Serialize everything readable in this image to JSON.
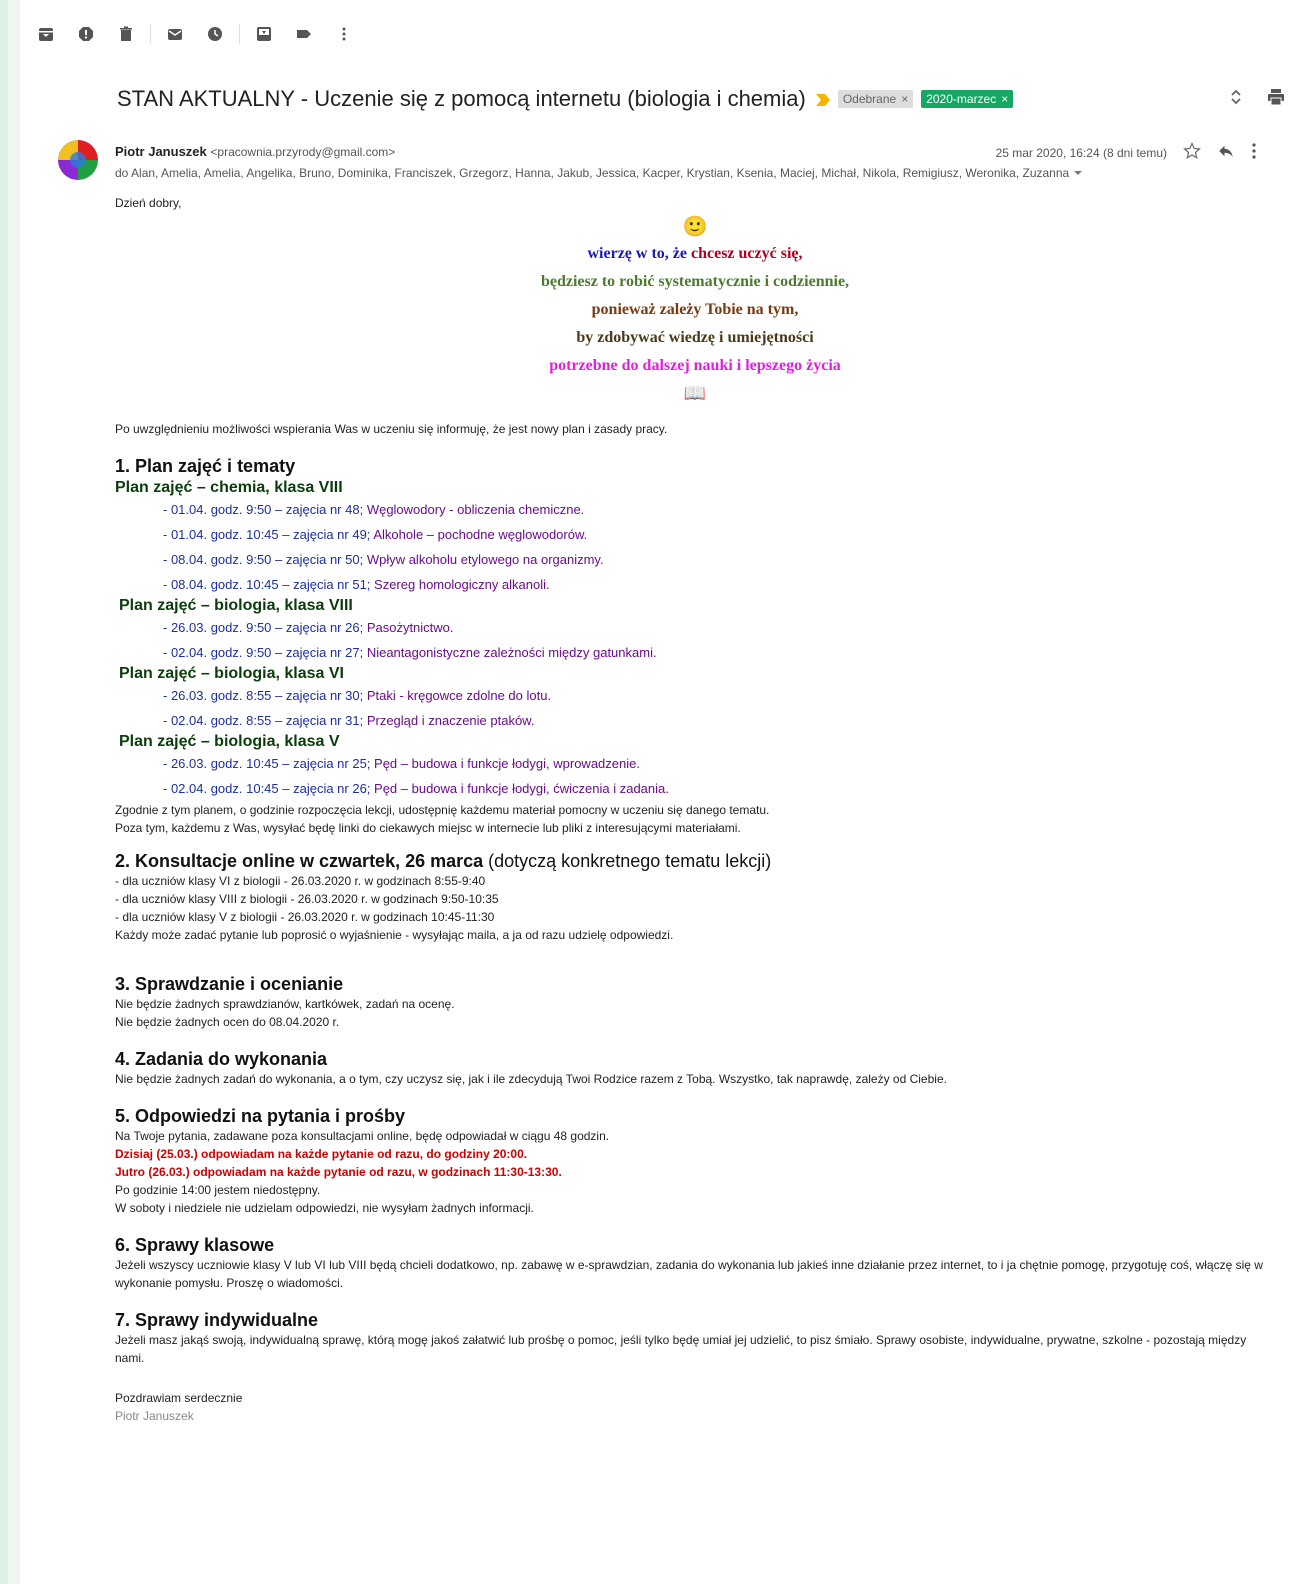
{
  "toolbar": {
    "icons": [
      "archive-icon",
      "report-spam-icon",
      "delete-icon",
      "mark-unread-icon",
      "snooze-icon",
      "move-to-icon",
      "labels-icon",
      "more-icon"
    ]
  },
  "subject": "STAN AKTUALNY - Uczenie się z pomocą internetu (biologia i chemia)",
  "labels": [
    {
      "text": "Odebrane",
      "color": "#dddddd"
    },
    {
      "text": "2020-marzec",
      "color": "#16a765"
    }
  ],
  "label_close": "×",
  "sender": {
    "name": "Piotr Januszek",
    "email": "<pracownia.przyrody@gmail.com>",
    "date": "25 mar 2020, 16:24 (8 dni temu)",
    "recipients": "do Alan, Amelia, Amelia, Angelika, Bruno, Dominika, Franciszek, Grzegorz, Hanna, Jakub, Jessica, Kacper, Krystian, Ksenia, Maciej, Michał, Nikola, Remigiusz, Weronika, Zuzanna"
  },
  "greeting": "Dzień dobry,",
  "emoji_smile": "🙂",
  "emoji_book": "📖",
  "motto": {
    "l1a": "wierzę w to, że ",
    "l1b": "chcesz uczyć się,",
    "l2": "będziesz to robić systematycznie i codziennie,",
    "l3": "ponieważ zależy Tobie na tym,",
    "l4": "by zdobywać wiedzę i umiejętności",
    "l5": "potrzebne do dalszej nauki i lepszego życia",
    "colors": {
      "blue": "#1a1ab3",
      "red": "#b00020",
      "green": "#4c7a2e",
      "brown": "#7a3b12",
      "dark": "#4a3a1a",
      "magenta": "#e020e0"
    }
  },
  "intro": "Po uwzględnieniu możliwości wspierania Was w uczeniu się informuję, że jest nowy plan i zasady pracy.",
  "s1": {
    "title": "1. Plan zajęć i tematy",
    "groups": [
      {
        "title": "Plan zajęć – chemia, klasa VIII",
        "items": [
          {
            "d": "- 01.04. godz. 9:50 – zajęcia nr 48; ",
            "t": "Węglowodory - obliczenia chemiczne."
          },
          {
            "d": "- 01.04. godz. 10:45 – zajęcia nr 49; ",
            "t": "Alkohole – pochodne węglowodorów."
          },
          {
            "d": "- 08.04. godz. 9:50 – zajęcia nr 50; ",
            "t": "Wpływ alkoholu etylowego na organizmy."
          },
          {
            "d": "- 08.04. godz. 10:45 – zajęcia nr 51; ",
            "t": "Szereg homologiczny alkanoli."
          }
        ]
      },
      {
        "title": "Plan zajęć – biologia, klasa VIII",
        "items": [
          {
            "d": "- 26.03. godz. 9:50 – zajęcia nr 26; ",
            "t": "Pasożytnictwo."
          },
          {
            "d": "- 02.04. godz. 9:50 – zajęcia nr 27; ",
            "t": "Nieantagonistyczne zależności między gatunkami."
          }
        ]
      },
      {
        "title": "Plan zajęć – biologia, klasa VI",
        "items": [
          {
            "d": "- 26.03. godz. 8:55 – zajęcia nr 30; ",
            "t": "Ptaki - kręgowce zdolne do lotu."
          },
          {
            "d": "- 02.04. godz. 8:55 – zajęcia nr 31; ",
            "t": "Przegląd i znaczenie ptaków."
          }
        ]
      },
      {
        "title": "Plan zajęć – biologia, klasa V",
        "items": [
          {
            "d": "- 26.03. godz. 10:45 – zajęcia nr 25; ",
            "t": "Pęd – budowa i funkcje łodygi, wprowadzenie."
          },
          {
            "d": "- 02.04. godz. 10:45 – zajęcia nr 26; ",
            "t": "Pęd – budowa i funkcje łodygi, ćwiczenia i zadania."
          }
        ]
      }
    ],
    "note1": "Zgodnie z tym planem, o godzinie rozpoczęcia lekcji, udostępnię każdemu materiał pomocny w uczeniu się danego tematu.",
    "note2": "Poza tym, każdemu z Was, wysyłać będę linki do ciekawych miejsc w internecie lub pliki z interesującymi materiałami."
  },
  "s2": {
    "title_b": "2. Konsultacje online w czwartek, 26 marca",
    "title_n": " (dotyczą konkretnego tematu lekcji)",
    "lines": [
      "- dla uczniów klasy VI z biologii - 26.03.2020 r. w godzinach 8:55-9:40",
      "- dla uczniów klasy VIII z biologii -  26.03.2020 r. w godzinach 9:50-10:35",
      "- dla uczniów klasy V z biologii -  26.03.2020 r. w godzinach 10:45-11:30",
      "Każdy może zadać pytanie lub poprosić o wyjaśnienie - wysyłając maila, a ja od razu udzielę odpowiedzi."
    ]
  },
  "s3": {
    "title": "3. Sprawdzanie i ocenianie",
    "lines": [
      "Nie będzie żadnych sprawdzianów, kartkówek, zadań na ocenę.",
      "Nie będzie żadnych ocen do 08.04.2020 r."
    ]
  },
  "s4": {
    "title": "4. Zadania do wykonania",
    "text": "Nie będzie żadnych zadań do wykonania, a o tym, czy uczysz się, jak i ile zdecydują Twoi Rodzice razem z Tobą. Wszystko, tak naprawdę, zależy od Ciebie."
  },
  "s5": {
    "title": "5. Odpowiedzi na pytania i prośby",
    "l1": "Na Twoje pytania, zadawane poza konsultacjami online, będę odpowiadał w ciągu 48 godzin.",
    "r1": "Dzisiaj (25.03.) odpowiadam na każde pytanie od razu, do godziny 20:00.",
    "r2": "Jutro (26.03.) odpowiadam na każde pytanie od razu, w godzinach 11:30-13:30.",
    "l2": "Po godzinie 14:00 jestem niedostępny.",
    "l3": "W soboty i niedziele nie udzielam odpowiedzi, nie wysyłam żadnych informacji."
  },
  "s6": {
    "title": "6. Sprawy klasowe",
    "text": "Jeżeli wszyscy uczniowie klasy V lub VI lub VIII będą chcieli dodatkowo, np. zabawę w e-sprawdzian, zadania do wykonania lub jakieś inne działanie przez internet, to i ja chętnie pomogę, przygotuję coś, włączę się w wykonanie pomysłu. Proszę o wiadomości."
  },
  "s7": {
    "title": "7. Sprawy indywidualne",
    "text": "Jeżeli masz jakąś swoją, indywidualną sprawę, którą mogę jakoś załatwić lub prośbę o pomoc, jeśli tylko będę umiał jej udzielić, to pisz śmiało. Sprawy osobiste, indywidualne, prywatne, szkolne - pozostają między nami."
  },
  "closing": "Pozdrawiam serdecznie",
  "signature": "Piotr Januszek"
}
